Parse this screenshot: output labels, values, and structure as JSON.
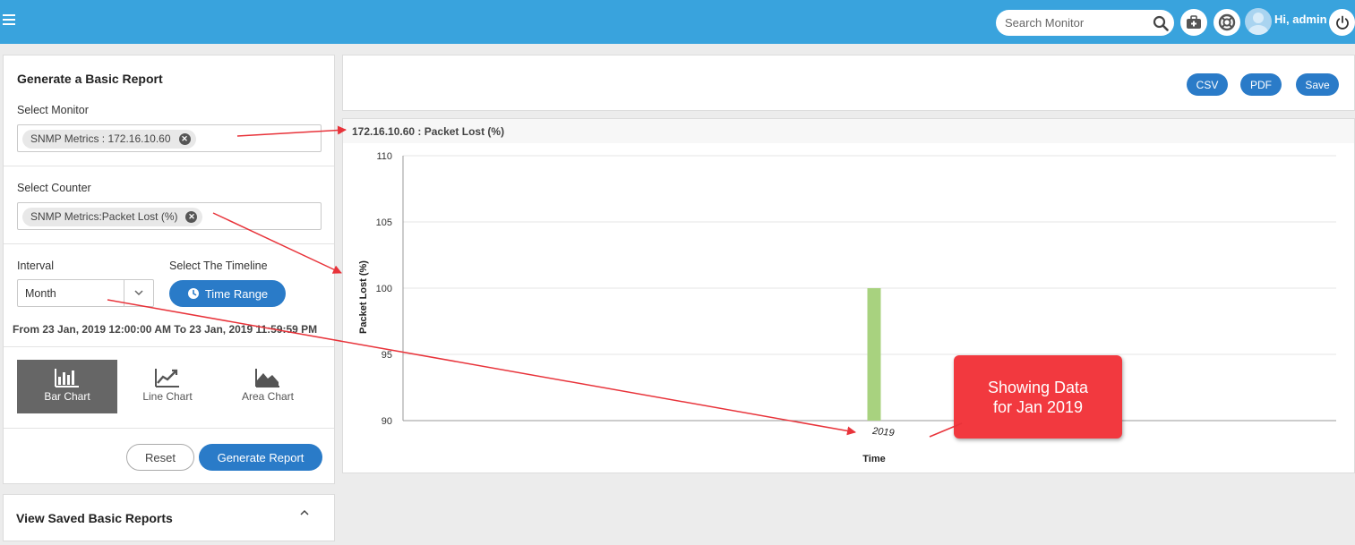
{
  "topbar": {
    "search_placeholder": "Search Monitor",
    "greeting": "Hi, admin",
    "icons": [
      "menu-icon",
      "search-icon",
      "first-aid-kit-icon",
      "help-lifebuoy-icon",
      "avatar",
      "power-icon"
    ]
  },
  "report_form": {
    "title": "Generate a Basic Report",
    "monitor_label": "Select Monitor",
    "monitor_tag": "SNMP Metrics : 172.16.10.60",
    "counter_label": "Select Counter",
    "counter_tag": "SNMP Metrics:Packet Lost (%)",
    "interval_label": "Interval",
    "interval_value": "Month",
    "timeline_label": "Select The Timeline",
    "time_range_button": "Time Range",
    "range_text": "From 23 Jan, 2019 12:00:00 AM To 23 Jan, 2019 11:59:59 PM",
    "chart_types": [
      {
        "label": "Bar Chart",
        "active": true
      },
      {
        "label": "Line Chart",
        "active": false
      },
      {
        "label": "Area Chart",
        "active": false
      }
    ],
    "reset_button": "Reset",
    "generate_button": "Generate Report"
  },
  "saved_reports": {
    "title": "View Saved Basic Reports"
  },
  "export": {
    "csv": "CSV",
    "pdf": "PDF",
    "save": "Save"
  },
  "chart_panel": {
    "header": "172.16.10.60 : Packet Lost (%)"
  },
  "annotation": {
    "line1": "Showing Data",
    "line2": "for Jan 2019",
    "color": "#f2393f"
  },
  "colors": {
    "topbar": "#39a3dd",
    "primary_button": "#2a7bc8",
    "bar": "#a8d27f",
    "active_chart_type": "#666666"
  },
  "chart_data": {
    "type": "bar",
    "categories": [
      "2019"
    ],
    "values": [
      100
    ],
    "title": "172.16.10.60 : Packet Lost (%)",
    "xlabel": "Time",
    "ylabel": "Packet Lost (%)",
    "ylim": [
      90,
      110
    ],
    "yticks": [
      90,
      95,
      100,
      105,
      110
    ],
    "grid": true
  }
}
